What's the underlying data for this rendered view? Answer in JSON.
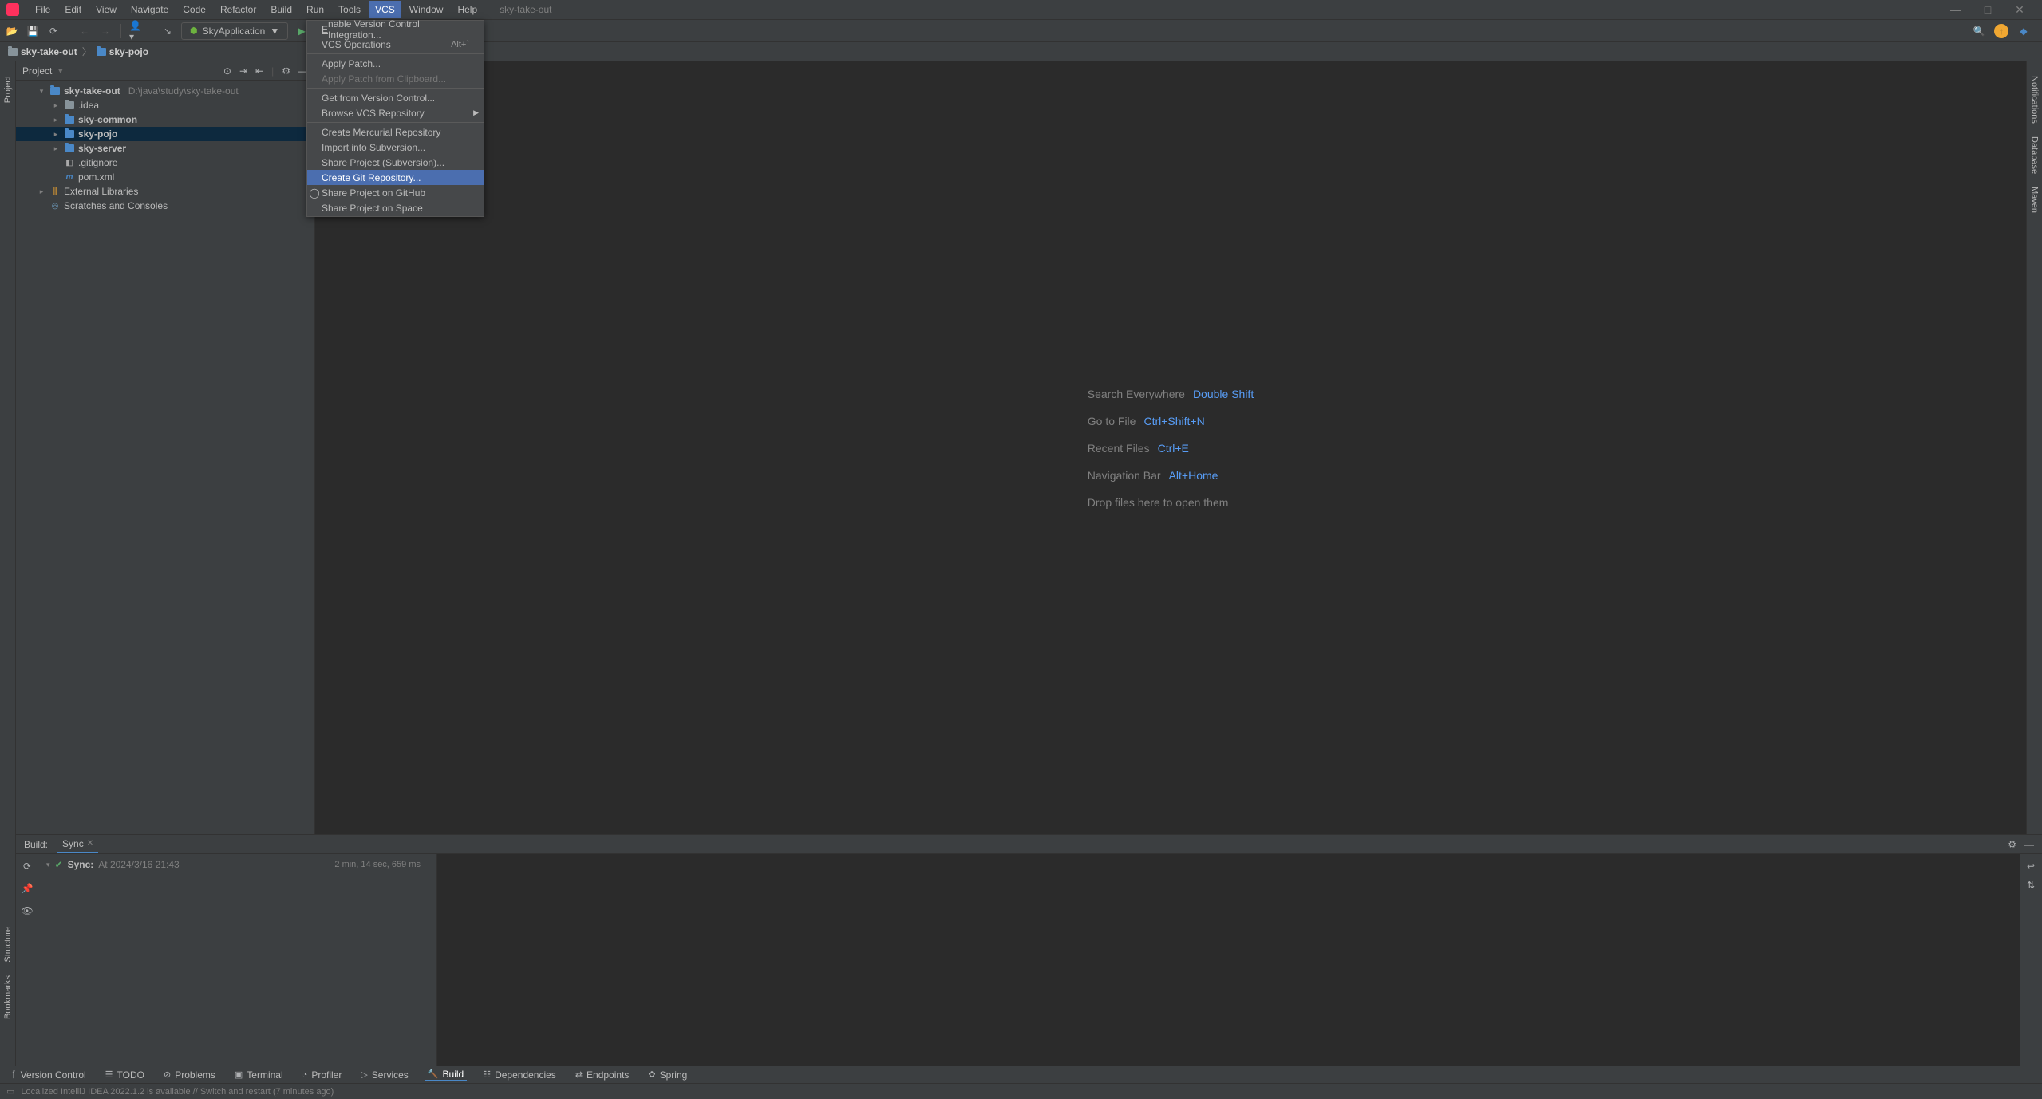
{
  "title": {
    "project": "sky-take-out"
  },
  "menu": [
    "File",
    "Edit",
    "View",
    "Navigate",
    "Code",
    "Refactor",
    "Build",
    "Run",
    "Tools",
    "VCS",
    "Window",
    "Help"
  ],
  "menu_active": "VCS",
  "window_controls": {
    "min": "—",
    "max": "□",
    "close": "✕"
  },
  "toolbar": {
    "run_config": "SkyApplication",
    "dropdown_arrow": "▼"
  },
  "breadcrumbs": [
    {
      "name": "sky-take-out"
    },
    {
      "name": "sky-pojo"
    }
  ],
  "projectPanel": {
    "title": "Project",
    "tree": {
      "root": {
        "name": "sky-take-out",
        "path": "D:\\java\\study\\sky-take-out"
      },
      "children": [
        {
          "name": ".idea",
          "type": "folder"
        },
        {
          "name": "sky-common",
          "type": "module",
          "bold": true
        },
        {
          "name": "sky-pojo",
          "type": "module",
          "bold": true,
          "selected": true
        },
        {
          "name": "sky-server",
          "type": "module",
          "bold": true
        },
        {
          "name": ".gitignore",
          "type": "file"
        },
        {
          "name": "pom.xml",
          "type": "maven"
        }
      ],
      "extLib": "External Libraries",
      "scratches": "Scratches and Consoles"
    }
  },
  "vcsMenu": [
    {
      "label": "Enable Version Control Integration...",
      "u": 0
    },
    {
      "label": "VCS Operations",
      "shortcut": "Alt+`"
    },
    {
      "sep": true
    },
    {
      "label": "Apply Patch..."
    },
    {
      "label": "Apply Patch from Clipboard...",
      "disabled": true
    },
    {
      "sep": true
    },
    {
      "label": "Get from Version Control..."
    },
    {
      "label": "Browse VCS Repository",
      "submenu": true
    },
    {
      "sep": true
    },
    {
      "label": "Create Mercurial Repository"
    },
    {
      "label": "Import into Subversion...",
      "u": 1
    },
    {
      "label": "Share Project (Subversion)..."
    },
    {
      "label": "Create Git Repository...",
      "highlighted": true
    },
    {
      "label": "Share Project on GitHub",
      "icon": "github"
    },
    {
      "label": "Share Project on Space"
    }
  ],
  "placeholder": [
    {
      "label": "Search Everywhere",
      "key": "Double Shift"
    },
    {
      "label": "Go to File",
      "key": "Ctrl+Shift+N"
    },
    {
      "label": "Recent Files",
      "key": "Ctrl+E"
    },
    {
      "label": "Navigation Bar",
      "key": "Alt+Home"
    },
    {
      "label": "Drop files here to open them",
      "key": ""
    }
  ],
  "rightGutter": [
    "Notifications",
    "Database",
    "Maven"
  ],
  "leftGutter": {
    "top": "Project",
    "bottom": [
      "Structure",
      "Bookmarks"
    ]
  },
  "buildPanel": {
    "header_label": "Build:",
    "tab": "Sync",
    "sync_label": "Sync:",
    "sync_time": "At 2024/3/16 21:43",
    "duration": "2 min, 14 sec, 659 ms"
  },
  "bottomBar": [
    {
      "icon": "branch",
      "label": "Version Control"
    },
    {
      "icon": "list",
      "label": "TODO"
    },
    {
      "icon": "warn",
      "label": "Problems"
    },
    {
      "icon": "terminal",
      "label": "Terminal"
    },
    {
      "icon": "profiler",
      "label": "Profiler"
    },
    {
      "icon": "play",
      "label": "Services"
    },
    {
      "icon": "hammer",
      "label": "Build",
      "active": true
    },
    {
      "icon": "layers",
      "label": "Dependencies"
    },
    {
      "icon": "endpoints",
      "label": "Endpoints"
    },
    {
      "icon": "spring",
      "label": "Spring"
    }
  ],
  "statusBar": {
    "message": "Localized IntelliJ IDEA 2022.1.2 is available // Switch and restart (7 minutes ago)"
  }
}
